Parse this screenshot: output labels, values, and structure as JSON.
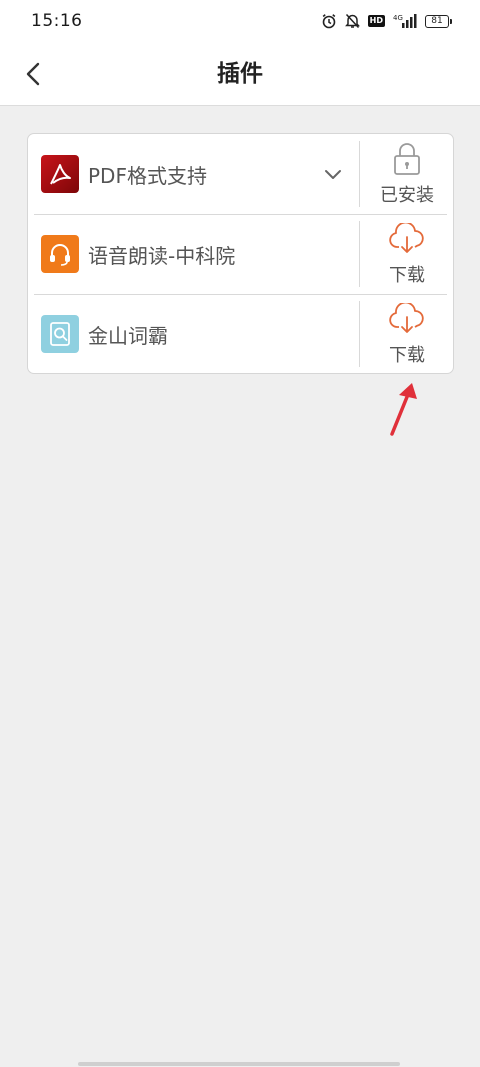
{
  "status_bar": {
    "time": "15:16",
    "network": "4G",
    "battery_level": "81",
    "hd_badge": "HD"
  },
  "header": {
    "back_icon": "chevron-left-icon",
    "title": "插件"
  },
  "plugins": [
    {
      "name": "PDF格式支持",
      "icon": "pdf-icon",
      "icon_color": "#b01010",
      "expandable": true,
      "action_icon": "lock-icon",
      "action_label": "已安装",
      "action_color": "#9a9a9a"
    },
    {
      "name": "语音朗读-中科院",
      "icon": "headset-icon",
      "icon_color": "#f07a1a",
      "expandable": false,
      "action_icon": "cloud-download-icon",
      "action_label": "下载",
      "action_color": "#e46a3a"
    },
    {
      "name": "金山词霸",
      "icon": "dictionary-icon",
      "icon_color": "#8fd0e0",
      "expandable": false,
      "action_icon": "cloud-download-icon",
      "action_label": "下载",
      "action_color": "#e46a3a"
    }
  ],
  "annotation": {
    "arrow_color": "#e0303a"
  }
}
